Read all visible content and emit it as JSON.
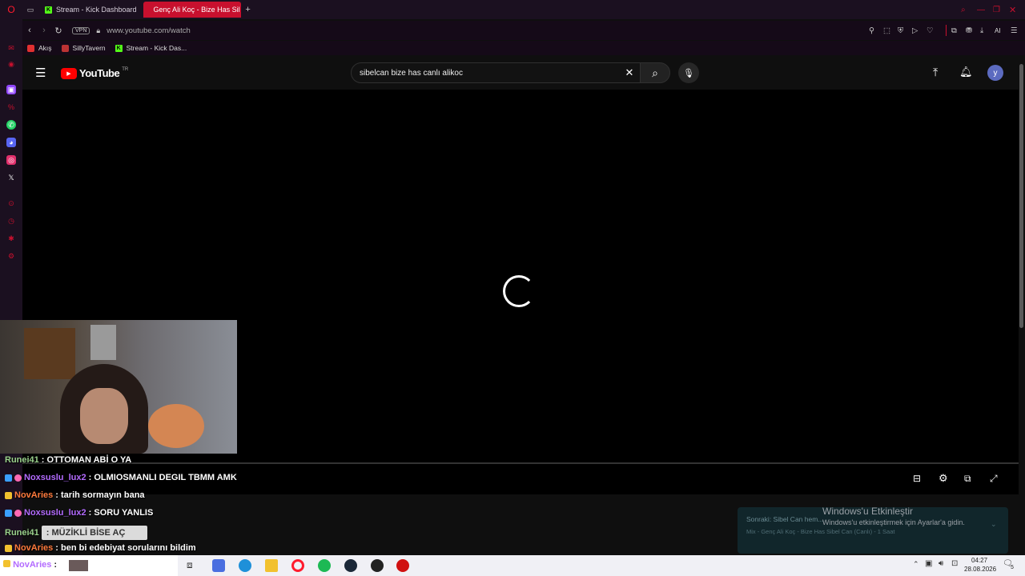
{
  "browser": {
    "tabs": [
      {
        "label": "Stream - Kick Dashboard",
        "active": false
      },
      {
        "label": "Genç Ali Koç - Bize Has Sil",
        "active": true
      }
    ],
    "url": "www.youtube.com/watch",
    "vpn_label": "VPN",
    "ai_label": "AI",
    "bookmarks": [
      {
        "label": "Akış"
      },
      {
        "label": "SillyTavern"
      },
      {
        "label": "Stream - Kick Das..."
      }
    ]
  },
  "youtube": {
    "logo_text": "YouTube",
    "region": "TR",
    "search_value": "sibelcan bize has canlı alikoc",
    "avatar_letter": "y"
  },
  "chat": [
    {
      "user": "Runei41",
      "message": ": OTTOMAN ABİ O YA",
      "color": "green"
    },
    {
      "user": "Noxsuslu_lux2",
      "message": ": OLMIOSMANLI DEGIL TBMM AMK",
      "color": "purple"
    },
    {
      "user": "NovAries",
      "message": ": tarih sormayın bana",
      "color": "orange"
    },
    {
      "user": "Noxsuslu_lux2",
      "message": ": SORU YANLIS",
      "color": "purple"
    },
    {
      "user": "Runei41",
      "message": ": MÜZİKLİ BİSE AÇ",
      "color": "green"
    },
    {
      "user": "NovAries",
      "message": ": ben bi edebiyat sorularını bildim",
      "color": "orange"
    },
    {
      "user": "NovAries",
      "message": ":",
      "color": "orange"
    }
  ],
  "overlay": {
    "up_next": "Sonraki: Sibel Can hem...",
    "up_next_sub": "Mix - Genç Ali Koç - Bize Has Sibel Can (Canlı) - 1 Saat",
    "windows_title": "Windows'u Etkinleştir",
    "windows_sub": "Windows'u etkinleştirmek için Ayarlar'a gidin."
  },
  "taskbar": {
    "time": "04:27",
    "date": "28.08.2026",
    "notif_count": "5"
  },
  "colors": {
    "opera_red": "#c8102e",
    "kick_green": "#53fc18",
    "youtube_red": "#ff0000"
  }
}
